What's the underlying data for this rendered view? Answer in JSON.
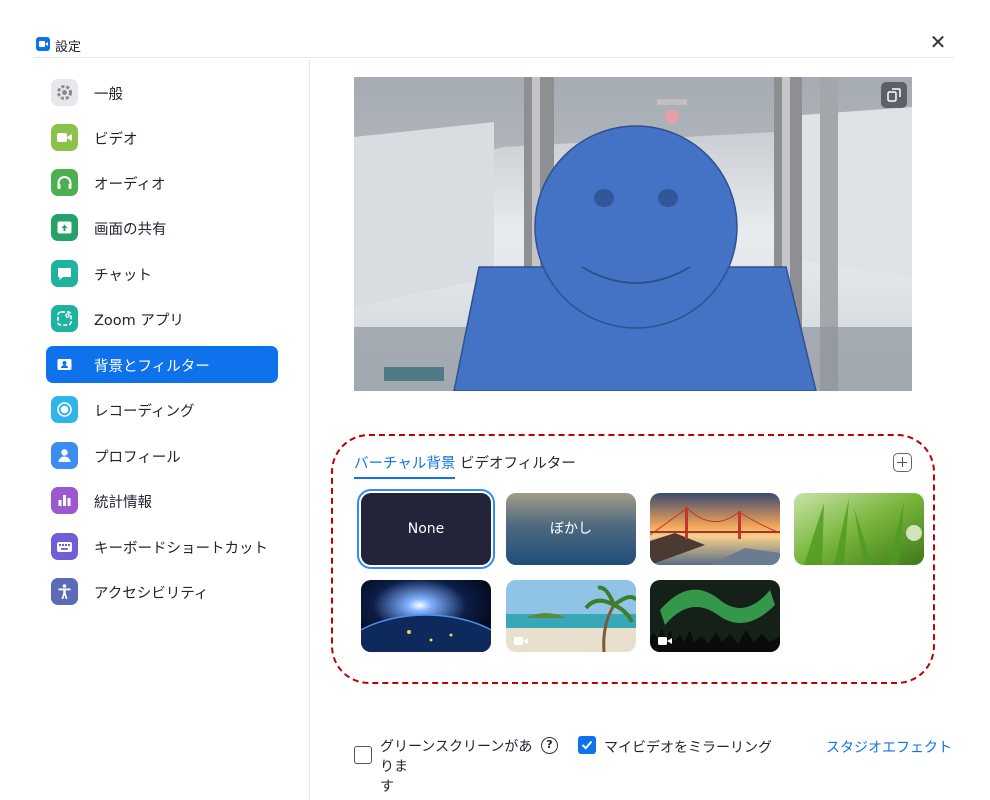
{
  "window": {
    "title": "設定",
    "app_icon": "zoom-camera-icon",
    "close_icon": "close-icon"
  },
  "sidebar": {
    "items": [
      {
        "label": "一般",
        "icon": "gear-icon",
        "color": "#e8e8ec"
      },
      {
        "label": "ビデオ",
        "icon": "video-camera-icon",
        "color": "#8bc34a"
      },
      {
        "label": "オーディオ",
        "icon": "headphones-icon",
        "color": "#4caf50"
      },
      {
        "label": "画面の共有",
        "icon": "share-screen-icon",
        "color": "#26a269"
      },
      {
        "label": "チャット",
        "icon": "chat-bubble-icon",
        "color": "#1fb39f"
      },
      {
        "label": "Zoom アプリ",
        "icon": "zoom-apps-icon",
        "color": "#1fb39f"
      },
      {
        "label": "背景とフィルター",
        "icon": "background-icon",
        "color": "#0e72ed",
        "active": true
      },
      {
        "label": "レコーディング",
        "icon": "record-icon",
        "color": "#2fb5e8"
      },
      {
        "label": "プロフィール",
        "icon": "profile-icon",
        "color": "#3d8cf2"
      },
      {
        "label": "統計情報",
        "icon": "statistics-icon",
        "color": "#9b59d0"
      },
      {
        "label": "キーボードショートカット",
        "icon": "keyboard-icon",
        "color": "#6f5fd6"
      },
      {
        "label": "アクセシビリティ",
        "icon": "accessibility-icon",
        "color": "#5c6ab8"
      }
    ]
  },
  "preview": {
    "copy_icon": "copy-icon"
  },
  "tabs": [
    {
      "label": "バーチャル背景",
      "active": true
    },
    {
      "label": "ビデオフィルター",
      "active": false
    }
  ],
  "add_icon": "plus-icon",
  "backgrounds": [
    {
      "label": "None",
      "selected": true
    },
    {
      "label": "ぼかし"
    },
    {
      "label": ""
    },
    {
      "label": ""
    },
    {
      "label": ""
    },
    {
      "label": ""
    },
    {
      "label": ""
    }
  ],
  "footer": {
    "green_screen_label": "グリーンスクリーンがありま\nす",
    "green_screen_checked": false,
    "mirror_label": "マイビデオをミラーリング",
    "mirror_checked": true,
    "studio_effects": "スタジオエフェクト"
  },
  "colors": {
    "accent": "#0e72ed",
    "highlight_frame": "#c00000"
  }
}
